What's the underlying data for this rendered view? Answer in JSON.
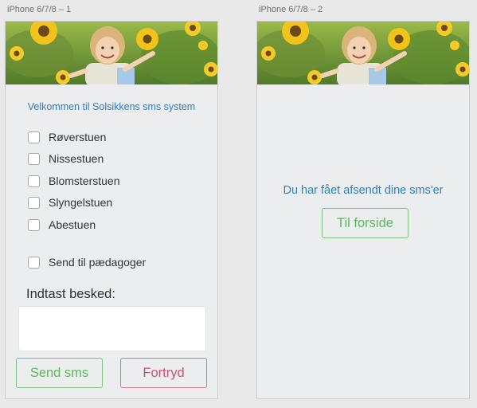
{
  "artboards": [
    {
      "label": "iPhone 6/7/8 – 1"
    },
    {
      "label": "iPhone 6/7/8 – 2"
    }
  ],
  "screen1": {
    "welcome": "Velkommen til Solsikkens sms system",
    "groups": [
      {
        "label": "Røverstuen",
        "checked": false
      },
      {
        "label": "Nissestuen",
        "checked": false
      },
      {
        "label": "Blomsterstuen",
        "checked": false
      },
      {
        "label": "Slyngelstuen",
        "checked": false
      },
      {
        "label": "Abestuen",
        "checked": false
      }
    ],
    "teachers_label": "Send til pædagoger",
    "message_label": "Indtast besked:",
    "message_value": "",
    "send_label": "Send sms",
    "cancel_label": "Fortryd"
  },
  "screen2": {
    "confirmation": "Du har fået afsendt dine sms'er",
    "home_label": "Til forside"
  },
  "colors": {
    "link_blue": "#2f7fc0",
    "success_green": "#5cb85c",
    "danger_pink": "#c9526c"
  },
  "icons": [
    "checkbox-icon"
  ]
}
